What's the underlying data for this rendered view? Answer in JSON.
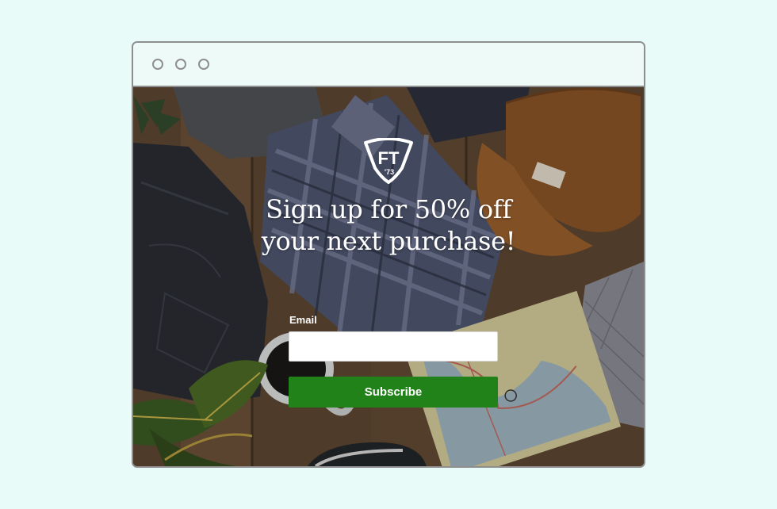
{
  "browser": {
    "window_controls": [
      "circle",
      "circle",
      "circle"
    ]
  },
  "popup": {
    "logo_text": "FT",
    "logo_subtext": "'73",
    "headline_line1": "Sign up for 50% off",
    "headline_line2": "your next purchase!",
    "email_label": "Email",
    "email_value": "",
    "email_placeholder": "",
    "subscribe_label": "Subscribe"
  },
  "colors": {
    "page_background": "#e8fbf8",
    "window_border": "#8e8e8e",
    "subscribe_button": "#22821a"
  }
}
